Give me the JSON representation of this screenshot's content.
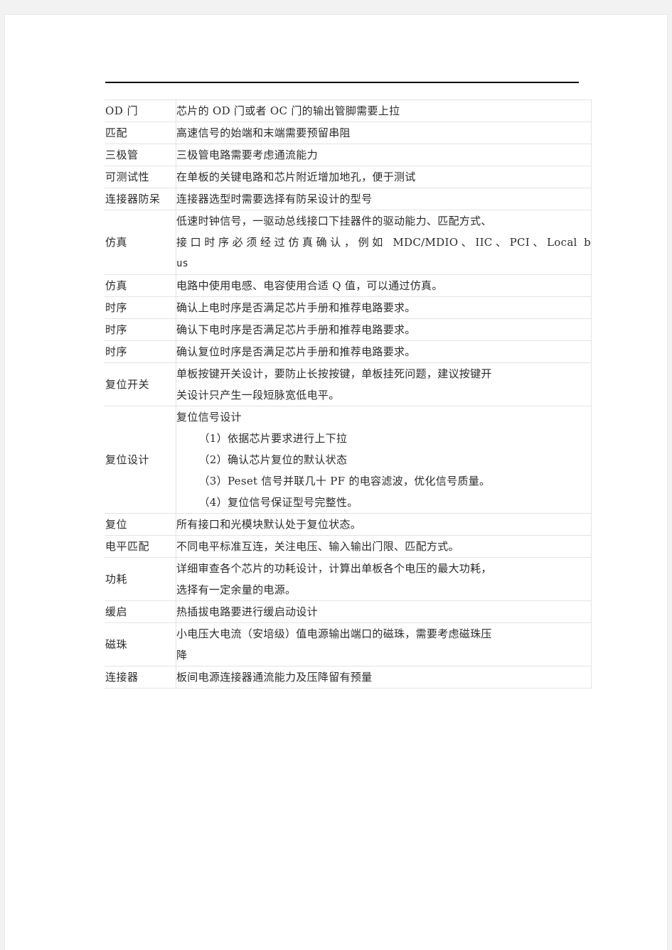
{
  "page": {
    "background_color": "#f2f2f2",
    "sheet_color": "#ffffff",
    "rule_color": "#000000",
    "border_color": "#e4e4e4",
    "text_color": "#2b2b2b"
  },
  "table": {
    "column_count": 2,
    "row_count": 18,
    "rows": [
      {
        "label": "OD 门",
        "body": "芯片的 OD 门或者 OC 门的输出管脚需要上拉"
      },
      {
        "label": "匹配",
        "body": "高速信号的始端和末端需要预留串阻"
      },
      {
        "label": "三极管",
        "body": "三极管电路需要考虑通流能力"
      },
      {
        "label": "可测试性",
        "body": "在单板的关键电路和芯片附近增加地孔，便于测试"
      },
      {
        "label": "连接器防呆",
        "body": "连接器选型时需要选择有防呆设计的型号"
      },
      {
        "label": "仿真",
        "body_line_1": "低速时钟信号，一驱动总线接口下挂器件的驱动能力、匹配方式、",
        "body_line_2": "接口时序必须经过仿真确认，例如 MDC/MDIO、IIC、PCI、Local    b",
        "body_line_3": "us"
      },
      {
        "label": "仿真",
        "body": "电路中使用电感、电容使用合适 Q 值，可以通过仿真。"
      },
      {
        "label": "时序",
        "body": "确认上电时序是否满足芯片手册和推荐电路要求。"
      },
      {
        "label": "时序",
        "body": "确认下电时序是否满足芯片手册和推荐电路要求。"
      },
      {
        "label": "时序",
        "body": "确认复位时序是否满足芯片手册和推荐电路要求。"
      },
      {
        "label": "复位开关",
        "body_line_1": "单板按键开关设计，要防止长按按键，单板挂死问题，建议按键开",
        "body_line_2": "关设计只产生一段短脉宽低电平。"
      },
      {
        "label": "复位设计",
        "body_title": "复位信号设计",
        "body_items": [
          "（1）依据芯片要求进行上下拉",
          "（2）确认芯片复位的默认状态",
          "（3）Peset 信号并联几十 PF 的电容滤波，优化信号质量。",
          "（4）复位信号保证型号完整性。"
        ]
      },
      {
        "label": "复位",
        "body": "所有接口和光模块默认处于复位状态。"
      },
      {
        "label": "电平匹配",
        "body": "不同电平标准互连，关注电压、输入输出门限、匹配方式。"
      },
      {
        "label": "功耗",
        "body_line_1": "详细审查各个芯片的功耗设计，计算出单板各个电压的最大功耗，",
        "body_line_2": "选择有一定余量的电源。"
      },
      {
        "label": "缓启",
        "body": "热插拔电路要进行缓启动设计"
      },
      {
        "label": "磁珠",
        "body_line_1": "小电压大电流（安培级）值电源输出端口的磁珠，需要考虑磁珠压",
        "body_line_2": "降"
      },
      {
        "label": "连接器",
        "body": "板间电源连接器通流能力及压降留有预量"
      }
    ]
  }
}
